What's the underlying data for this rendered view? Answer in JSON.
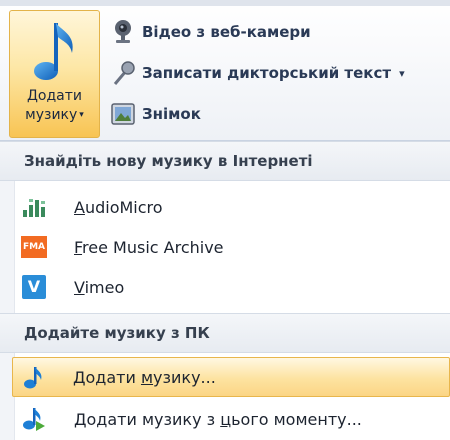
{
  "ribbon": {
    "add_music": {
      "label_line1": "Додати",
      "label_line2": "музику",
      "caret": "▾",
      "icon": "music-note-icon"
    },
    "webcam": {
      "label": "Відео з веб-камери",
      "icon": "webcam-icon"
    },
    "narration": {
      "label": "Записати дикторський текст",
      "caret": "▾",
      "icon": "microphone-icon"
    },
    "snapshot": {
      "label": "Знімок",
      "icon": "camera-icon"
    }
  },
  "menu": {
    "online_header": "Знайдіть нову музику в Інтернеті",
    "online_items": [
      {
        "label_first": "A",
        "label_rest": "udioMicro",
        "icon": "audiomicro-icon"
      },
      {
        "label_first": "F",
        "label_rest": "ree Music Archive",
        "icon": "fma-icon",
        "badge": "FMA"
      },
      {
        "label_first": "V",
        "label_rest": "imeo",
        "icon": "vimeo-icon",
        "badge": "V"
      }
    ],
    "pc_header": "Додайте музику з ПК",
    "pc_items": [
      {
        "label_before": "Додати ",
        "label_underlined": "м",
        "label_after": "узику...",
        "icon": "music-note-icon",
        "highlighted": true
      },
      {
        "label_before": "Додати музику з ",
        "label_underlined": "ц",
        "label_after": "ього моменту...",
        "icon": "music-note-play-icon",
        "highlighted": false
      }
    ]
  },
  "colors": {
    "accent_orange": "#f8c453",
    "note_blue": "#1d7fd6",
    "fma_orange": "#f26b22",
    "vimeo_blue": "#2a8dd8"
  }
}
